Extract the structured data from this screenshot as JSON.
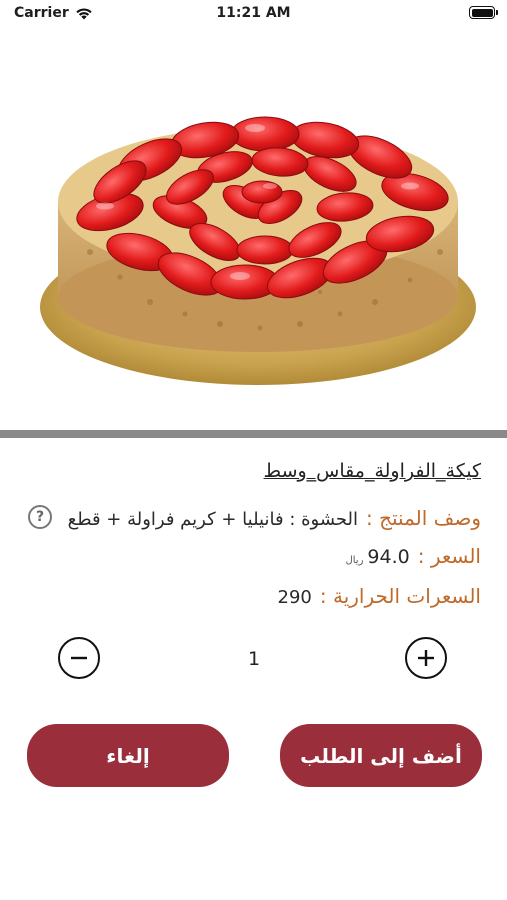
{
  "status_bar": {
    "carrier": "Carrier",
    "time": "11:21 AM"
  },
  "product": {
    "title": "كيكة_الفراولة_مقاس_وسط",
    "image_subject": "strawberry-cake"
  },
  "details": {
    "description_label": "وصف المنتج :",
    "description_value": "الحشوة : فانيليا + كريم فراولة + قطع",
    "price_label": "السعر :",
    "price_value": "94.0",
    "currency": "ريال",
    "calories_label": "السعرات الحرارية :",
    "calories_value": "290"
  },
  "quantity": {
    "value": "1"
  },
  "actions": {
    "add_label": "أضف إلى الطلب",
    "cancel_label": "إلغاء"
  },
  "colors": {
    "accent": "#9a2e3a",
    "label": "#c06a2a"
  }
}
